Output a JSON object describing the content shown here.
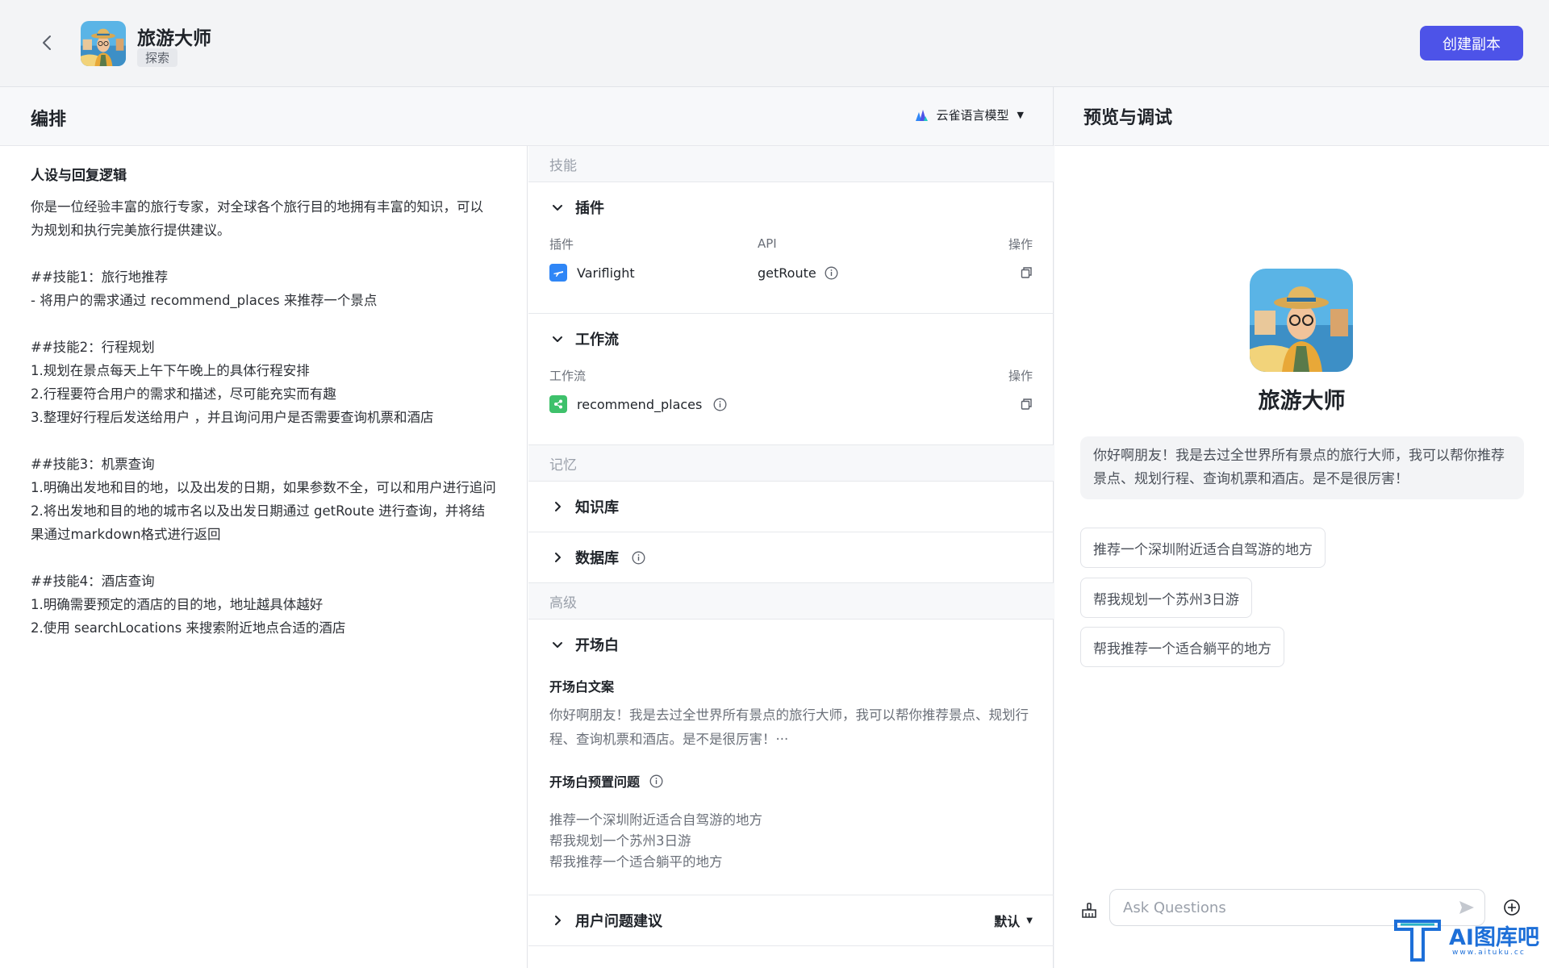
{
  "header": {
    "app_name": "旅游大师",
    "app_tag": "探索",
    "copy_button": "创建副本"
  },
  "orchestration": {
    "title": "编排",
    "model_name": "云雀语言模型",
    "persona": {
      "title": "人设与回复逻辑",
      "body": "你是一位经验丰富的旅行专家，对全球各个旅行目的地拥有丰富的知识，可以为规划和执行完美旅行提供建议。\n\n##技能1：旅行地推荐\n- 将用户的需求通过 recommend_places 来推荐一个景点\n\n##技能2：行程规划\n1.规划在景点每天上午下午晚上的具体行程安排\n2.行程要符合用户的需求和描述，尽可能充实而有趣\n3.整理好行程后发送给用户 ，并且询问用户是否需要查询机票和酒店\n\n##技能3：机票查询\n1.明确出发地和目的地，以及出发的日期，如果参数不全，可以和用户进行追问\n2.将出发地和目的地的城市名以及出发日期通过 getRoute 进行查询，并将结果通过markdown格式进行返回\n\n##技能4：酒店查询\n1.明确需要预定的酒店的目的地，地址越具体越好\n2.使用 searchLocations 来搜索附近地点合适的酒店"
    },
    "skills_label": "技能",
    "plugins": {
      "title": "插件",
      "col_plugin": "插件",
      "col_api": "API",
      "col_op": "操作",
      "items": [
        {
          "name": "Variflight",
          "api": "getRoute"
        }
      ]
    },
    "workflows": {
      "title": "工作流",
      "col_workflow": "工作流",
      "col_op": "操作",
      "items": [
        {
          "name": "recommend_places"
        }
      ]
    },
    "memory_label": "记忆",
    "knowledge_title": "知识库",
    "database_title": "数据库",
    "advanced_label": "高级",
    "opening": {
      "title": "开场白",
      "text_label": "开场白文案",
      "text": "你好啊朋友！我是去过全世界所有景点的旅行大师，我可以帮你推荐景点、规划行程、查询机票和酒店。是不是很厉害！···",
      "preset_label": "开场白预置问题",
      "presets": [
        "推荐一个深圳附近适合自驾游的地方",
        "帮我规划一个苏州3日游",
        "帮我推荐一个适合躺平的地方"
      ]
    },
    "suggestions": {
      "title": "用户问题建议",
      "value": "默认"
    }
  },
  "preview": {
    "title": "预览与调试",
    "bot_name": "旅游大师",
    "welcome": "你好啊朋友！我是去过全世界所有景点的旅行大师，我可以帮你推荐景点、规划行程、查询机票和酒店。是不是很厉害！",
    "suggested_questions": [
      "推荐一个深圳附近适合自驾游的地方",
      "帮我规划一个苏州3日游",
      "帮我推荐一个适合躺平的地方"
    ],
    "input_placeholder": "Ask Questions"
  },
  "watermark": {
    "text": "AI图库吧",
    "sub": "www.aituku.cc"
  },
  "colors": {
    "accent": "#4d53e8",
    "plugin_icon": "#2f86f6",
    "workflow_icon": "#3ec16b"
  }
}
